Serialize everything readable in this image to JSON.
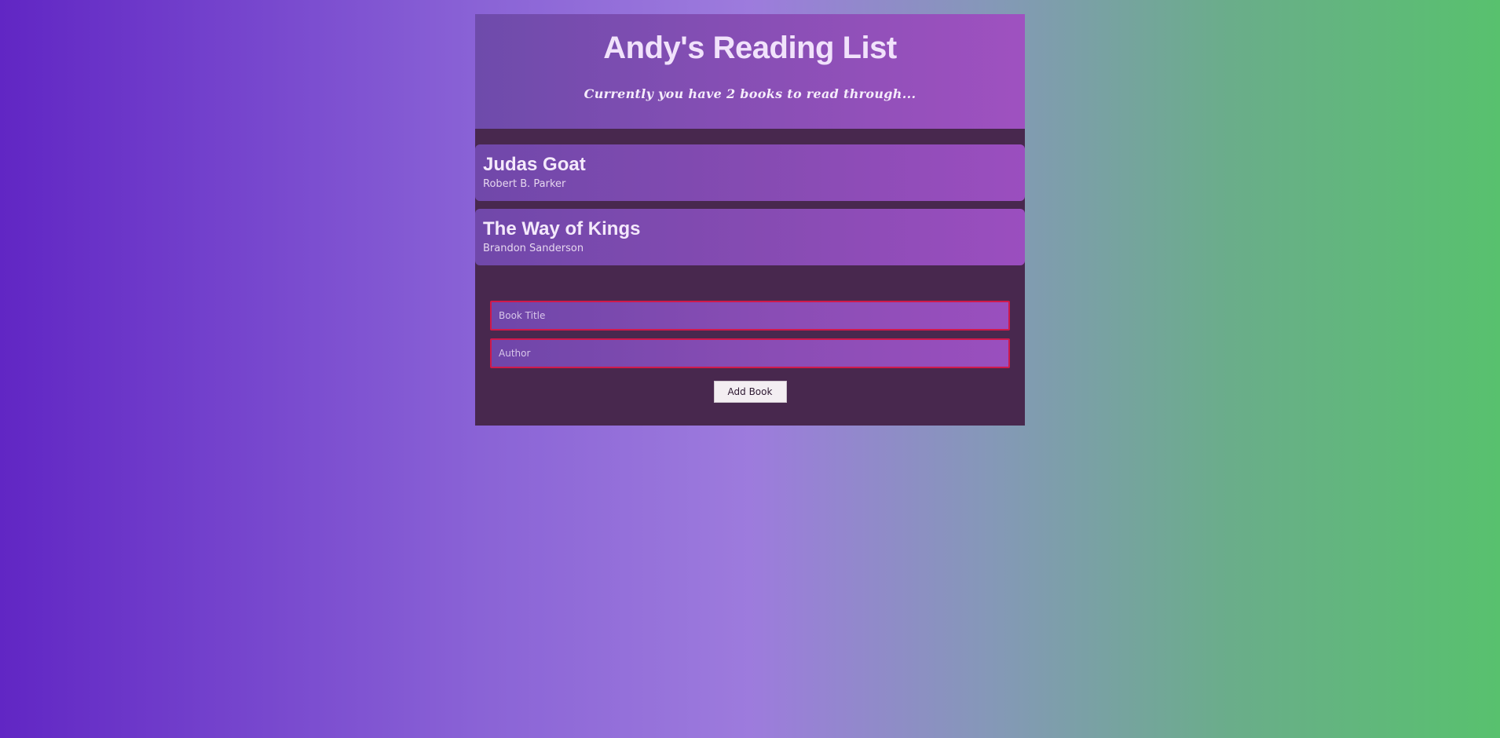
{
  "header": {
    "title": "Andy's Reading List",
    "subtitle": "Currently you have 2 books to read through..."
  },
  "books": [
    {
      "title": "Judas Goat",
      "author": "Robert B. Parker"
    },
    {
      "title": "The Way of Kings",
      "author": "Brandon Sanderson"
    }
  ],
  "form": {
    "title_placeholder": "Book Title",
    "author_placeholder": "Author",
    "submit_label": "Add Book"
  },
  "colors": {
    "input_border": "#d0194b",
    "panel_background": "#48284e"
  }
}
